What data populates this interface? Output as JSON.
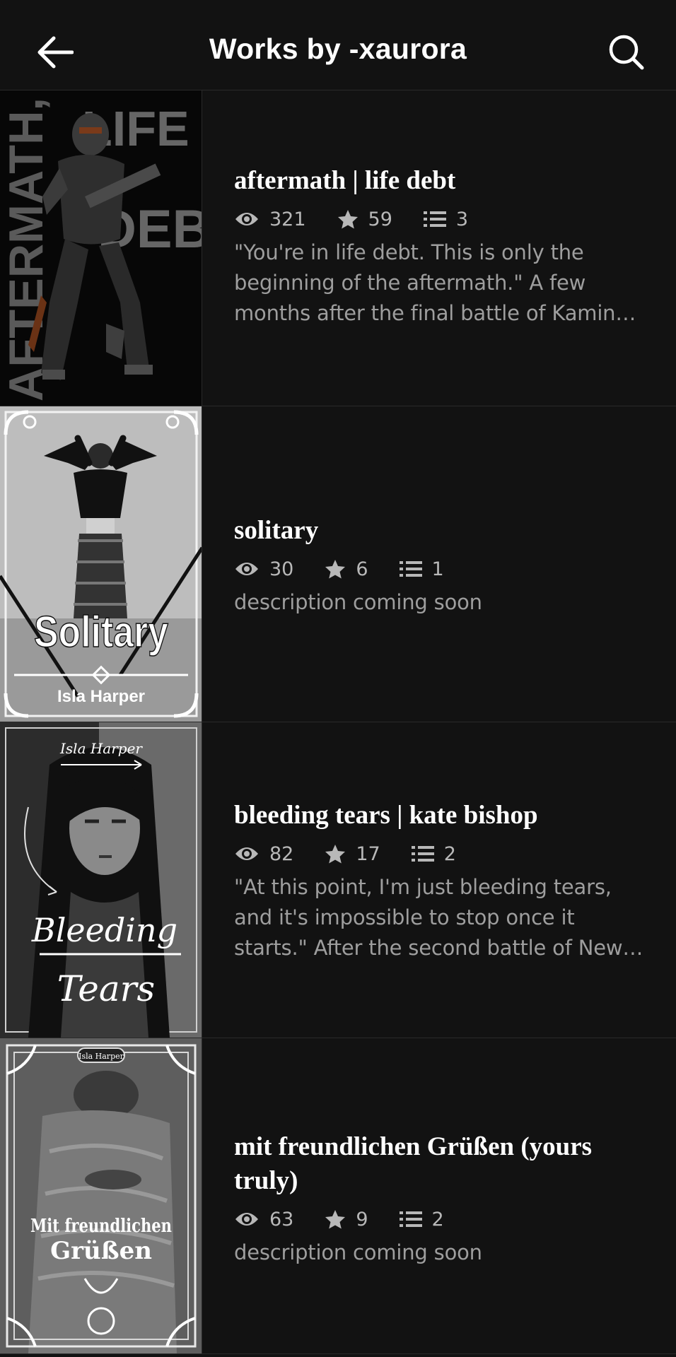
{
  "header": {
    "title": "Works by -xaurora",
    "back_icon": "arrow-left-icon",
    "search_icon": "search-icon"
  },
  "stories": [
    {
      "title": "aftermath | life debt",
      "reads": "321",
      "votes": "59",
      "parts": "3",
      "description": "\"You're in life debt. This is only the beginning of the aftermath.\" A few months after the final battle of Kamino, after the rise of the Empire...",
      "cover_text": [
        "AFTERMATH,",
        "LIFE",
        "DEBT"
      ]
    },
    {
      "title": "solitary",
      "reads": "30",
      "votes": "6",
      "parts": "1",
      "description": "description coming soon",
      "cover_text": [
        "Solitary",
        "Isla Harper"
      ]
    },
    {
      "title": "bleeding tears | kate bishop",
      "reads": "82",
      "votes": "17",
      "parts": "2",
      "description": "\"At this point, I'm just bleeding tears, and it's impossible to stop once it starts.\"  After the second battle of New York...",
      "cover_text": [
        "Isla Harper",
        "Bleeding",
        "Tears"
      ]
    },
    {
      "title": "mit freundlichen Grüßen (yours truly)",
      "reads": "63",
      "votes": "9",
      "parts": "2",
      "description": "description coming soon",
      "cover_text": [
        "Isla Harper",
        "Mit freundlichen",
        "Grüßen"
      ]
    }
  ],
  "icons": {
    "reads": "eye-icon",
    "votes": "star-icon",
    "parts": "list-icon"
  }
}
